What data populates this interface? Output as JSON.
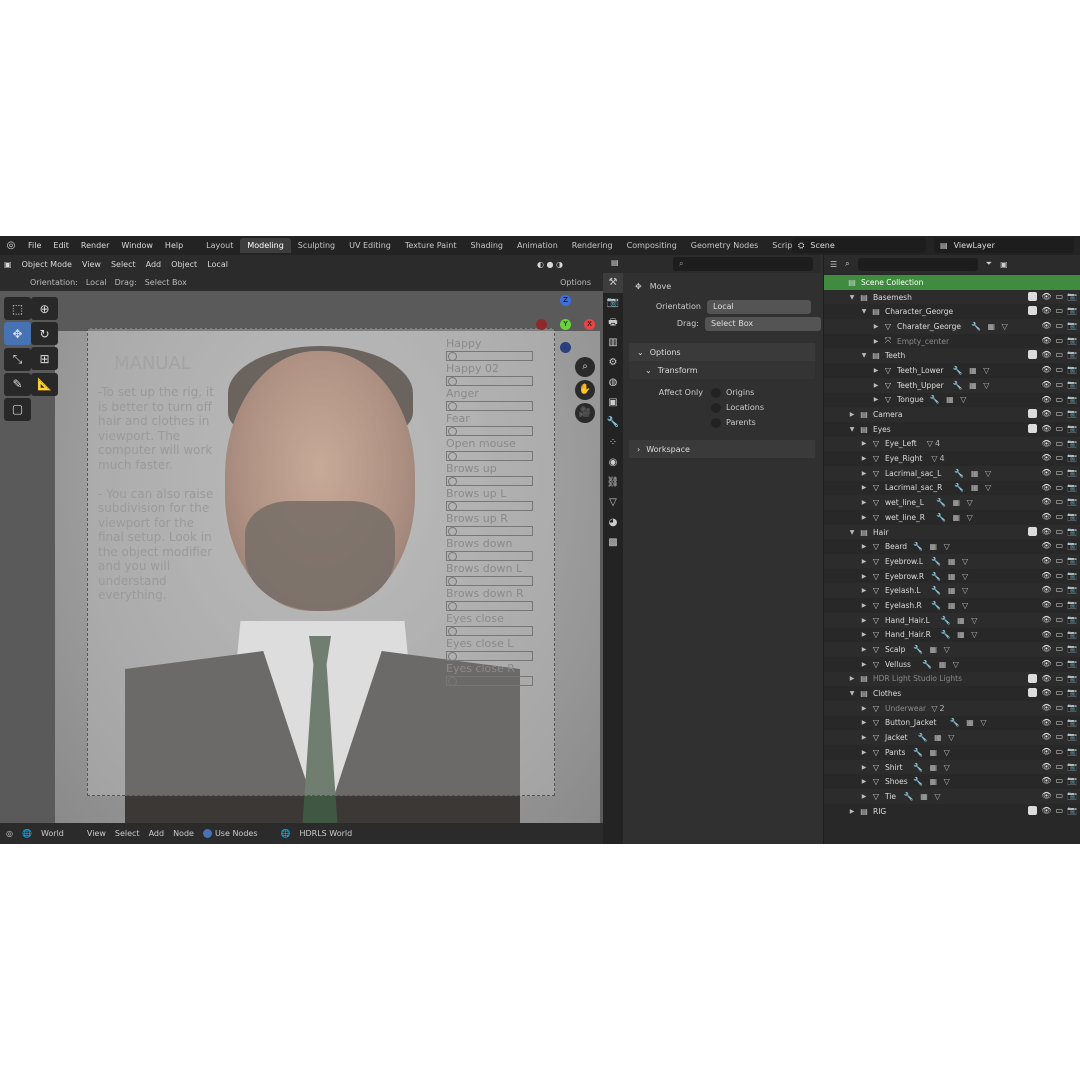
{
  "topbar": {
    "menu": [
      "File",
      "Edit",
      "Render",
      "Window",
      "Help"
    ],
    "tabs": [
      "Layout",
      "Modeling",
      "Sculpting",
      "UV Editing",
      "Texture Paint",
      "Shading",
      "Animation",
      "Rendering",
      "Compositing",
      "Geometry Nodes",
      "Scripting"
    ],
    "active_tab": "Modeling",
    "add_tab": "+",
    "scene": "Scene",
    "view_layer": "ViewLayer"
  },
  "viewport": {
    "mode": "Object Mode",
    "menus": [
      "View",
      "Select",
      "Add",
      "Object"
    ],
    "pivot": "Local",
    "orientation_label": "Orientation:",
    "orientation_value": "Local",
    "drag_label": "Drag:",
    "drag_value": "Select Box",
    "options": "Options",
    "manual_title": "MANUAL",
    "manual_text": "-To set up the rig, it is better to turn off hair and clothes in viewport. The computer will work much faster.\n\n- You can also raise subdivision for the viewport for the final setup. Look in the object modifier and you will understand everything.",
    "shape_keys": [
      "Happy",
      "Happy 02",
      "Anger",
      "Fear",
      "Open mouse",
      "Brows up",
      "Brows up L",
      "Brows up R",
      "Brows down",
      "Brows down L",
      "Brows down R",
      "Eyes close",
      "Eyes close L",
      "Eyes close R"
    ],
    "gizmo": {
      "x": "X",
      "y": "Y",
      "z": "Z"
    }
  },
  "node_bar": {
    "world": "World",
    "menus": [
      "View",
      "Select",
      "Add",
      "Node"
    ],
    "use_nodes": "Use Nodes",
    "world_name": "HDRLS World"
  },
  "properties": {
    "tool_name": "Move",
    "orientation_label": "Orientation",
    "orientation_value": "Local",
    "drag_label": "Drag:",
    "drag_value": "Select Box",
    "options_panel": "Options",
    "transform_panel": "Transform",
    "affect_only": "Affect Only",
    "affect_options": [
      "Origins",
      "Locations",
      "Parents"
    ],
    "workspace_panel": "Workspace"
  },
  "outliner": {
    "rows": [
      {
        "label": "Scene Collection",
        "indent": 0,
        "kind": "scene"
      },
      {
        "label": "Basemesh",
        "indent": 1,
        "kind": "collection",
        "expanded": true
      },
      {
        "label": "Character_George",
        "indent": 2,
        "kind": "collection",
        "expanded": true
      },
      {
        "label": "Charater_George",
        "indent": 3,
        "kind": "mesh",
        "mods": "🔧 ▦ ▽"
      },
      {
        "label": "Empty_center",
        "indent": 3,
        "kind": "empty",
        "dim": true
      },
      {
        "label": "Teeth",
        "indent": 2,
        "kind": "collection",
        "expanded": true
      },
      {
        "label": "Teeth_Lower",
        "indent": 3,
        "kind": "mesh",
        "mods": "🔧 ▦ ▽"
      },
      {
        "label": "Teeth_Upper",
        "indent": 3,
        "kind": "mesh",
        "mods": "🔧 ▦ ▽"
      },
      {
        "label": "Tongue",
        "indent": 3,
        "kind": "mesh",
        "mods": "🔧 ▦ ▽"
      },
      {
        "label": "Camera",
        "indent": 1,
        "kind": "collection"
      },
      {
        "label": "Eyes",
        "indent": 1,
        "kind": "collection",
        "expanded": true
      },
      {
        "label": "Eye_Left",
        "indent": 2,
        "kind": "mesh",
        "mods": "▽4"
      },
      {
        "label": "Eye_Right",
        "indent": 2,
        "kind": "mesh",
        "mods": "▽4"
      },
      {
        "label": "Lacrimal_sac_L",
        "indent": 2,
        "kind": "mesh",
        "mods": "🔧 ▦ ▽"
      },
      {
        "label": "Lacrimal_sac_R",
        "indent": 2,
        "kind": "mesh",
        "mods": "🔧 ▦ ▽"
      },
      {
        "label": "wet_line_L",
        "indent": 2,
        "kind": "mesh",
        "mods": "🔧 ▦ ▽"
      },
      {
        "label": "wet_line_R",
        "indent": 2,
        "kind": "mesh",
        "mods": "🔧 ▦ ▽"
      },
      {
        "label": "Hair",
        "indent": 1,
        "kind": "collection",
        "expanded": true
      },
      {
        "label": "Beard",
        "indent": 2,
        "kind": "mesh",
        "mods": "🔧 ▦ ▽"
      },
      {
        "label": "Eyebrow.L",
        "indent": 2,
        "kind": "mesh",
        "mods": "🔧 ▦ ▽"
      },
      {
        "label": "Eyebrow.R",
        "indent": 2,
        "kind": "mesh",
        "mods": "🔧 ▦ ▽"
      },
      {
        "label": "Eyelash.L",
        "indent": 2,
        "kind": "mesh",
        "mods": "🔧 ▦ ▽"
      },
      {
        "label": "Eyelash.R",
        "indent": 2,
        "kind": "mesh",
        "mods": "🔧 ▦ ▽"
      },
      {
        "label": "Hand_Hair.L",
        "indent": 2,
        "kind": "mesh",
        "mods": "🔧 ▦ ▽"
      },
      {
        "label": "Hand_Hair.R",
        "indent": 2,
        "kind": "mesh",
        "mods": "🔧 ▦ ▽"
      },
      {
        "label": "Scalp",
        "indent": 2,
        "kind": "mesh",
        "mods": "🔧 ▦ ▽"
      },
      {
        "label": "Velluss",
        "indent": 2,
        "kind": "mesh",
        "mods": "🔧 ▦ ▽"
      },
      {
        "label": "HDR Light Studio Lights",
        "indent": 1,
        "kind": "collection",
        "dim": true
      },
      {
        "label": "Clothes",
        "indent": 1,
        "kind": "collection",
        "expanded": true
      },
      {
        "label": "Underwear",
        "indent": 2,
        "kind": "mesh",
        "dim": true,
        "mods": "▽2"
      },
      {
        "label": "Button_Jacket",
        "indent": 2,
        "kind": "mesh",
        "mods": "🔧 ▦ ▽"
      },
      {
        "label": "Jacket",
        "indent": 2,
        "kind": "mesh",
        "mods": "🔧 ▦ ▽"
      },
      {
        "label": "Pants",
        "indent": 2,
        "kind": "mesh",
        "mods": "🔧 ▦ ▽"
      },
      {
        "label": "Shirt",
        "indent": 2,
        "kind": "mesh",
        "mods": "🔧 ▦ ▽"
      },
      {
        "label": "Shoes",
        "indent": 2,
        "kind": "mesh",
        "mods": "🔧 ▦ ▽"
      },
      {
        "label": "Tie",
        "indent": 2,
        "kind": "mesh",
        "mods": "🔧 ▦ ▽"
      },
      {
        "label": "RIG",
        "indent": 1,
        "kind": "collection"
      }
    ]
  },
  "colors": {
    "accent": "#4772b3",
    "scene_collection": "#3f8c3f",
    "panel": "#303030"
  }
}
